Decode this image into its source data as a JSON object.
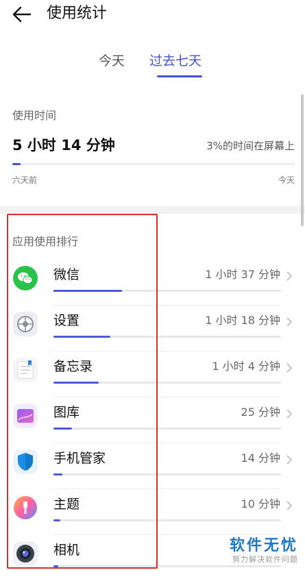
{
  "header": {
    "title": "使用统计"
  },
  "tabs": [
    {
      "label": "今天",
      "active": false
    },
    {
      "label": "过去七天",
      "active": true
    }
  ],
  "usage": {
    "label": "使用时间",
    "total": "5 小时 14 分钟",
    "ratio_text": "3%的时间在屏幕上",
    "range_start": "六天前",
    "range_end": "今天",
    "progress_fraction": 0.03
  },
  "ranking": {
    "title": "应用使用排行",
    "apps": [
      {
        "name": "微信",
        "time": "1 小时 37 分钟",
        "icon": "wechat-icon",
        "fraction": 0.3
      },
      {
        "name": "设置",
        "time": "1 小时 18 分钟",
        "icon": "settings-icon",
        "fraction": 0.25
      },
      {
        "name": "备忘录",
        "time": "1 小时 4 分钟",
        "icon": "notes-icon",
        "fraction": 0.2
      },
      {
        "name": "图库",
        "time": "25 分钟",
        "icon": "gallery-icon",
        "fraction": 0.08
      },
      {
        "name": "手机管家",
        "time": "14 分钟",
        "icon": "phone-manager-icon",
        "fraction": 0.04
      },
      {
        "name": "主题",
        "time": "10 分钟",
        "icon": "themes-icon",
        "fraction": 0.03
      },
      {
        "name": "相机",
        "time": "",
        "icon": "camera-icon",
        "fraction": 0.02
      }
    ]
  },
  "watermark": {
    "main": "软件无忧",
    "sub": "努力解决软件问题"
  },
  "colors": {
    "accent": "#3f52d8",
    "highlight_box": "#e12a2a",
    "watermark": "#1f78c8"
  }
}
